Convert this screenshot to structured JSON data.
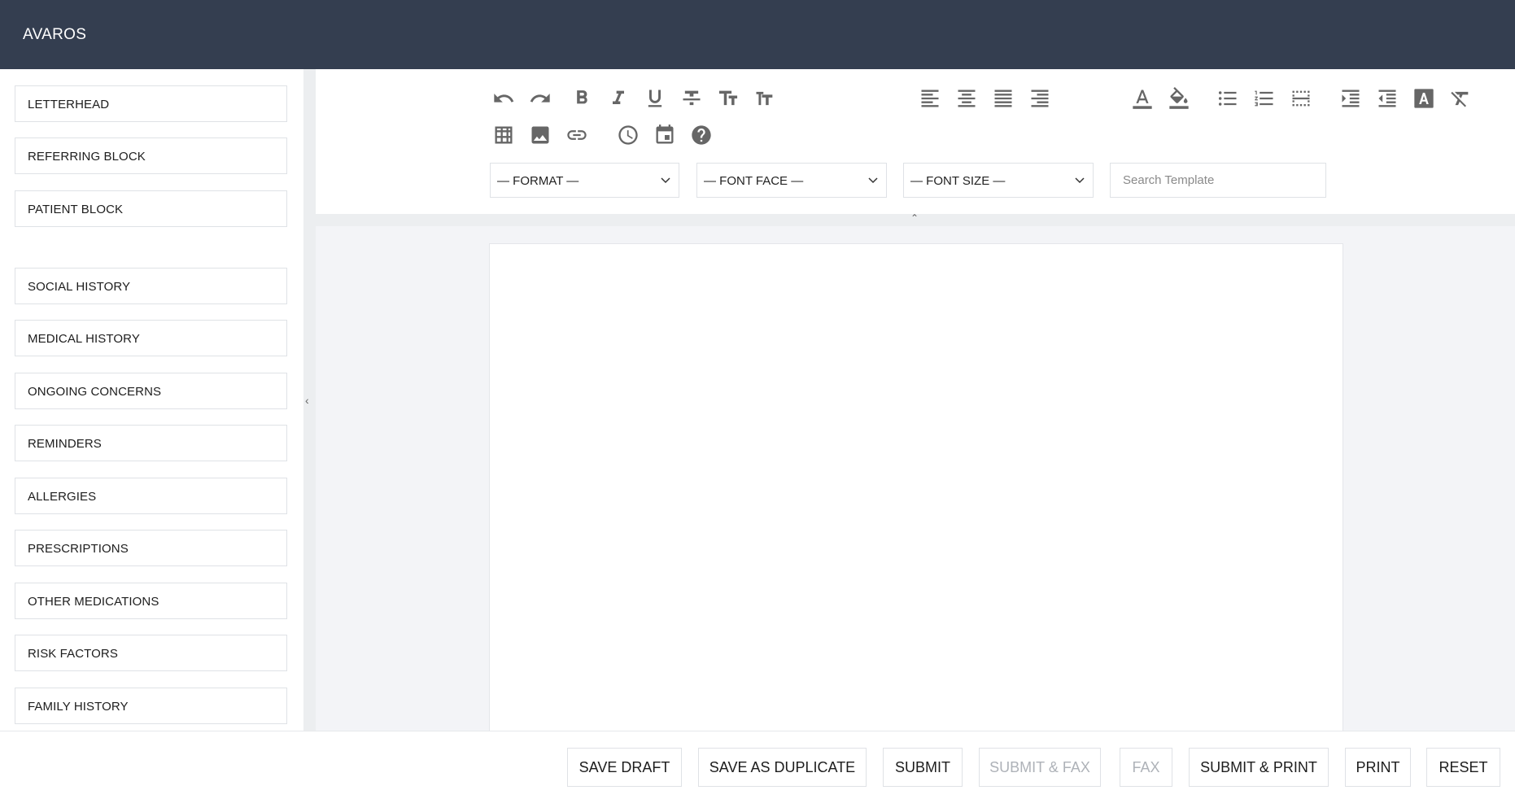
{
  "app": {
    "title": "AVAROS"
  },
  "sidebar": {
    "items": [
      {
        "label": "LETTERHEAD"
      },
      {
        "label": "REFERRING BLOCK"
      },
      {
        "label": "PATIENT BLOCK"
      },
      {
        "label": "SOCIAL HISTORY"
      },
      {
        "label": "MEDICAL HISTORY"
      },
      {
        "label": "ONGOING CONCERNS"
      },
      {
        "label": "REMINDERS"
      },
      {
        "label": "ALLERGIES"
      },
      {
        "label": "PRESCRIPTIONS"
      },
      {
        "label": "OTHER MEDICATIONS"
      },
      {
        "label": "RISK FACTORS"
      },
      {
        "label": "FAMILY HISTORY"
      }
    ]
  },
  "toolbar": {
    "icons": [
      "undo-icon",
      "redo-icon",
      "bold-icon",
      "italic-icon",
      "underline-icon",
      "strikethrough-icon",
      "superscript-icon",
      "subscript-icon",
      "font-color-icon",
      "background-color-icon",
      "align-left-icon",
      "align-center-icon",
      "align-justify-icon",
      "align-right-icon",
      "bulleted-list-icon",
      "numbered-list-icon",
      "horizontal-rule-icon",
      "indent-icon",
      "outdent-icon",
      "text-style-icon",
      "clear-format-icon",
      "table-icon",
      "image-icon",
      "link-icon",
      "time-icon",
      "calendar-icon",
      "help-icon"
    ],
    "format_label": "— FORMAT —",
    "fontface_label": "— FONT FACE —",
    "fontsize_label": "— FONT SIZE —",
    "search_placeholder": "Search Template"
  },
  "footer": {
    "save_draft": "SAVE DRAFT",
    "save_duplicate": "SAVE AS DUPLICATE",
    "submit": "SUBMIT",
    "submit_fax": "SUBMIT & FAX",
    "fax": "FAX",
    "submit_print": "SUBMIT & PRINT",
    "print": "PRINT",
    "reset": "RESET"
  },
  "colors": {
    "header_bg": "#343e50",
    "icon": "#666666",
    "disabled_text": "#aeb2b8"
  }
}
